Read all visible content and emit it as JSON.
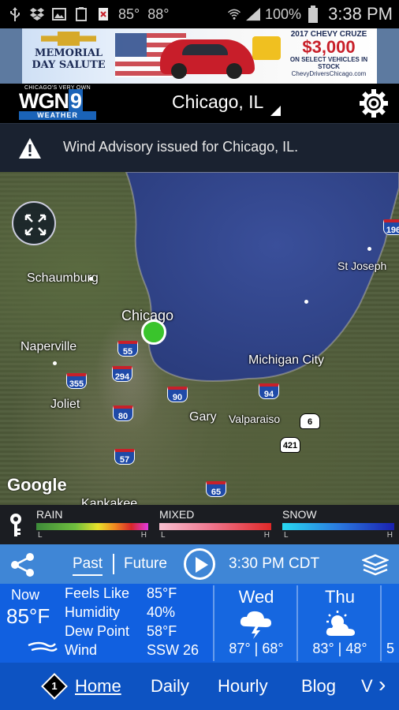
{
  "status_bar": {
    "temp1": "85°",
    "temp2": "88°",
    "battery": "100%",
    "time": "3:38 PM"
  },
  "ad": {
    "left_line1": "MEMORIAL",
    "left_line2": "DAY SALUTE",
    "right_line1": "2017 CHEVY CRUZE",
    "right_price": "$3,000",
    "right_line3": "ON SELECT VEHICLES IN STOCK",
    "right_line4": "ChevyDriversChicago.com"
  },
  "header": {
    "logo_top": "CHICAGO'S VERY OWN",
    "logo_main": "WGN",
    "logo_num": "9",
    "logo_sub": "WEATHER",
    "location": "Chicago, IL"
  },
  "advisory": {
    "text": "Wind Advisory issued for Chicago, IL."
  },
  "map": {
    "labels": {
      "schaumburg": "Schaumburg",
      "chicago": "Chicago",
      "naperville": "Naperville",
      "joliet": "Joliet",
      "gary": "Gary",
      "valparaiso": "Valparaiso",
      "michigan_city": "Michigan City",
      "st_joseph": "St Joseph",
      "kankakee": "Kankakee"
    },
    "shields": {
      "i55": "55",
      "i294": "294",
      "i355": "355",
      "i90": "90",
      "i80": "80",
      "i94": "94",
      "i57": "57",
      "i65": "65",
      "i196": "196",
      "us6": "6",
      "us421": "421"
    },
    "attribution": "Google"
  },
  "legend": {
    "rain": "RAIN",
    "mixed": "MIXED",
    "snow": "SNOW",
    "low": "L",
    "high": "H"
  },
  "controls": {
    "past": "Past",
    "future": "Future",
    "time": "3:30 PM CDT"
  },
  "current": {
    "now_label": "Now",
    "now_temp": "85°F",
    "feels_like_label": "Feels Like",
    "feels_like": "85°F",
    "humidity_label": "Humidity",
    "humidity": "40%",
    "dew_point_label": "Dew Point",
    "dew_point": "58°F",
    "wind_label": "Wind",
    "wind": "SSW 26"
  },
  "forecast": [
    {
      "day": "Wed",
      "high": "87°",
      "low": "68°"
    },
    {
      "day": "Thu",
      "high": "83°",
      "low": "48°"
    }
  ],
  "forecast_partial": "5",
  "nav": {
    "badge": "1",
    "items": [
      "Home",
      "Daily",
      "Hourly",
      "Blog",
      "V"
    ]
  },
  "colors": {
    "controls_bg": "#3f86d6",
    "current_bg": "#1160e0",
    "nav_bg": "#0d53c2",
    "pin": "#3ac42c"
  }
}
